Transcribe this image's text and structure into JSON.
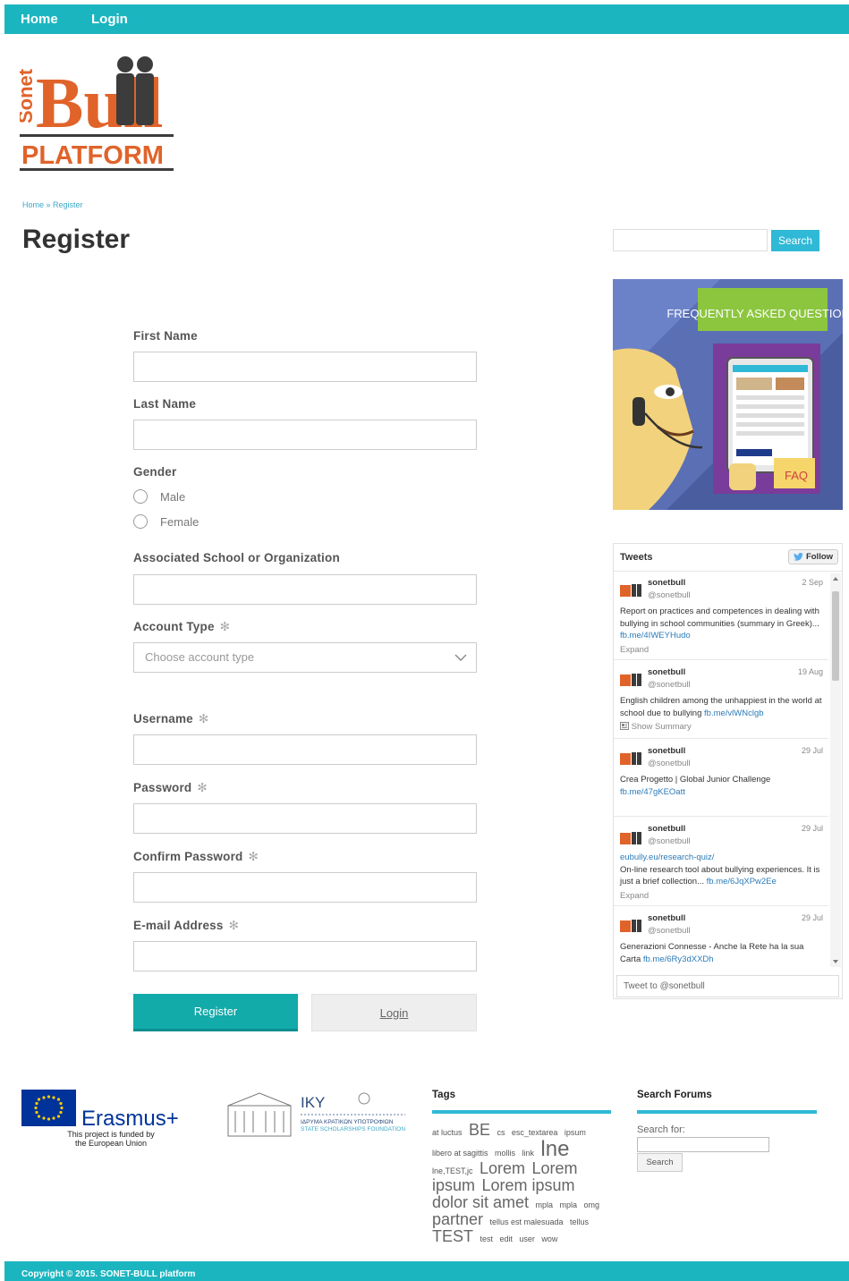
{
  "nav": {
    "home": "Home",
    "login": "Login"
  },
  "logo": {
    "word_sonet": "Sonet",
    "word_bull": "Bull",
    "word_platform": "PLATFORM"
  },
  "breadcrumb": {
    "home": "Home",
    "sep": " » ",
    "current": "Register"
  },
  "page_title": "Register",
  "form": {
    "first_name": "First Name",
    "last_name": "Last Name",
    "gender": "Gender",
    "gender_options": [
      "Male",
      "Female"
    ],
    "school": "Associated School or Organization",
    "account_type": "Account Type",
    "account_type_placeholder": "Choose account type",
    "username": "Username",
    "password": "Password",
    "confirm_password": "Confirm Password",
    "email": "E-mail Address",
    "required_mark": "✻",
    "register_button": "Register",
    "login_button": "Login"
  },
  "sidebar": {
    "search_button": "Search",
    "faq_banner": {
      "title": "FREQUENTLY ASKED QUESTIONS",
      "label": "FAQ"
    },
    "tweets": {
      "title": "Tweets",
      "follow": "Follow",
      "items": [
        {
          "name": "sonetbull",
          "handle": "@sonetbull",
          "date": "2 Sep",
          "text": "Report on practices and competences in dealing with bullying in school communities (summary in Greek)... ",
          "link": "fb.me/4IWEYHudo",
          "meta": "Expand"
        },
        {
          "name": "sonetbull",
          "handle": "@sonetbull",
          "date": "19 Aug",
          "text": "English children among the unhappiest in the world at school due to bullying ",
          "link": "fb.me/vlWNclgb",
          "meta": "Show Summary"
        },
        {
          "name": "sonetbull",
          "handle": "@sonetbull",
          "date": "29 Jul",
          "text": "Crea Progetto | Global Junior Challenge ",
          "link": "fb.me/47gKEOatt",
          "meta": ""
        },
        {
          "name": "sonetbull",
          "handle": "@sonetbull",
          "date": "29 Jul",
          "pre_link": "eubully.eu/research-quiz/",
          "text": "On-line research tool about bullying experiences. It is just a brief collection... ",
          "link": "fb.me/6JqXPw2Ee",
          "meta": "Expand"
        },
        {
          "name": "sonetbull",
          "handle": "@sonetbull",
          "date": "29 Jul",
          "text": "Generazioni Connesse - Anche la Rete ha la sua Carta ",
          "link": "fb.me/6Ry3dXXDh",
          "meta": ""
        }
      ],
      "tweet_to": "Tweet to @sonetbull"
    }
  },
  "footer": {
    "eu": {
      "brand": "Erasmus+",
      "caption_1": "This project is funded by",
      "caption_2": "the European Union"
    },
    "iky": {
      "name": "IKY",
      "line1": "ΙΔΡΥΜΑ ΚΡΑΤΙΚΩΝ ΥΠΟΤΡΟΦΙΩΝ",
      "line2": "STATE SCHOLARSHIPS FOUNDATION"
    },
    "tags_title": "Tags",
    "tags": [
      {
        "t": "at luctus",
        "s": 9
      },
      {
        "t": "BE",
        "s": 18
      },
      {
        "t": "cs",
        "s": 9
      },
      {
        "t": "esc_textarea",
        "s": 9
      },
      {
        "t": "ipsum",
        "s": 9
      },
      {
        "t": "libero at sagittis",
        "s": 9
      },
      {
        "t": "mollis",
        "s": 9
      },
      {
        "t": "link",
        "s": 9
      },
      {
        "t": "lne",
        "s": 24
      },
      {
        "t": "lne,TEST,jc",
        "s": 9
      },
      {
        "t": "Lorem",
        "s": 18
      },
      {
        "t": "Lorem",
        "s": 18
      },
      {
        "t": "ipsum",
        "s": 18
      },
      {
        "t": "Lorem ipsum",
        "s": 18
      },
      {
        "t": "dolor sit amet",
        "s": 18
      },
      {
        "t": "mpla",
        "s": 9
      },
      {
        "t": "mpla",
        "s": 9
      },
      {
        "t": "omg",
        "s": 9
      },
      {
        "t": "partner",
        "s": 18
      },
      {
        "t": "tellus est malesuada",
        "s": 9
      },
      {
        "t": "tellus",
        "s": 9
      },
      {
        "t": "TEST",
        "s": 18
      },
      {
        "t": "test",
        "s": 9
      },
      {
        "t": "edit",
        "s": 9
      },
      {
        "t": "user",
        "s": 9
      },
      {
        "t": "wow",
        "s": 9
      }
    ],
    "forums_title": "Search Forums",
    "search_for": "Search for:",
    "forum_search_button": "Search",
    "copyright": "Copyright © 2015. SONET-BULL platform"
  },
  "colors": {
    "accent": "#1bb5c0",
    "button": "#13aaaa",
    "link": "#3aa9c8",
    "logo_orange": "#e0632a"
  }
}
